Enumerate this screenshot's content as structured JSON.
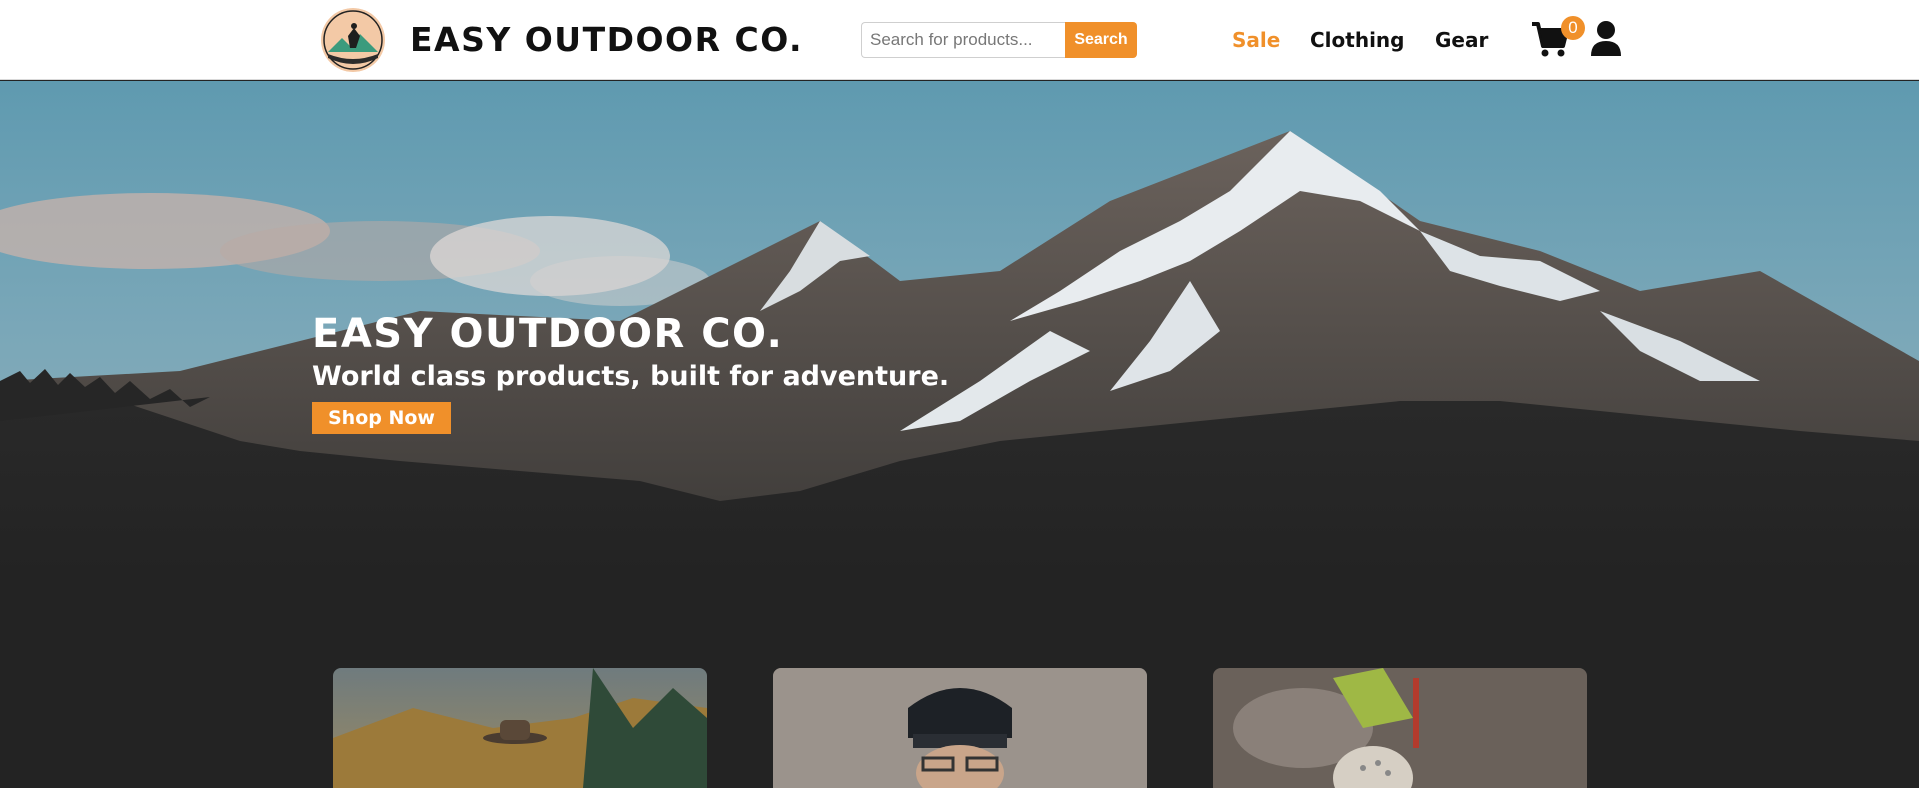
{
  "header": {
    "brand": "EASY OUTDOOR CO.",
    "logo_text": "EASY OUTDOOR",
    "search": {
      "placeholder": "Search for products...",
      "button_label": "Search"
    },
    "nav": [
      {
        "label": "Sale",
        "color": "#f0902a"
      },
      {
        "label": "Clothing"
      },
      {
        "label": "Gear"
      }
    ],
    "cart_count": "0",
    "icons": [
      "logo",
      "cart-icon",
      "user-icon"
    ]
  },
  "hero": {
    "title": "EASY OUTDOOR CO.",
    "subtitle": "World class products, built for adventure.",
    "cta_label": "Shop Now"
  },
  "cards": [
    {
      "subject": "hiker-with-hat"
    },
    {
      "subject": "person-in-beanie"
    },
    {
      "subject": "climber-with-helmet"
    }
  ],
  "colors": {
    "accent": "#f0902a",
    "page_bg": "#232323",
    "header_bg": "#ffffff"
  }
}
